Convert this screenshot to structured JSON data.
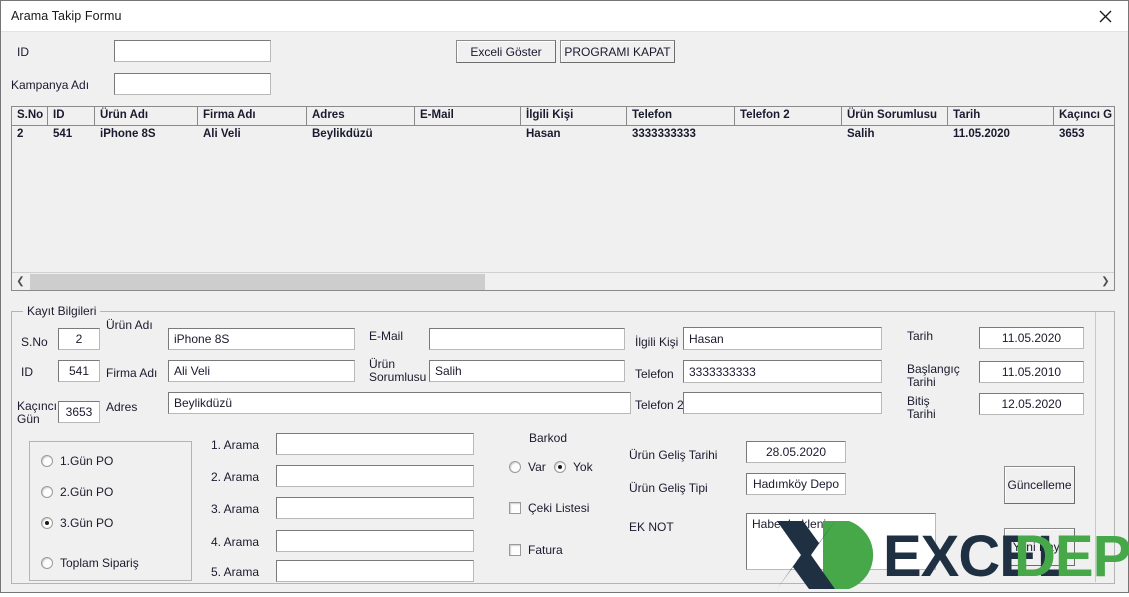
{
  "window": {
    "title": "Arama Takip Formu",
    "close_icon": "close-icon"
  },
  "search": {
    "id_label": "ID",
    "id_value": "",
    "campaign_label": "Kampanya Adı",
    "campaign_value": ""
  },
  "toolbar": {
    "show_excel_label": "Exceli Göster",
    "close_program_label": "PROGRAMI KAPAT"
  },
  "grid": {
    "columns": [
      {
        "label": "S.No",
        "width": 36
      },
      {
        "label": "ID",
        "width": 47
      },
      {
        "label": "Ürün Adı",
        "width": 103
      },
      {
        "label": "Firma Adı",
        "width": 109
      },
      {
        "label": "Adres",
        "width": 108
      },
      {
        "label": "E-Mail",
        "width": 106
      },
      {
        "label": "İlgili Kişi",
        "width": 106
      },
      {
        "label": "Telefon",
        "width": 108
      },
      {
        "label": "Telefon 2",
        "width": 107
      },
      {
        "label": "Ürün Sorumlusu",
        "width": 106
      },
      {
        "label": "Tarih",
        "width": 106
      },
      {
        "label": "Kaçıncı G",
        "width": 106
      }
    ],
    "rows": [
      [
        "2",
        "541",
        "iPhone 8S",
        "Ali Veli",
        "Beylikdüzü",
        "",
        "Hasan",
        "3333333333",
        "",
        "Salih",
        "11.05.2020",
        "3653"
      ]
    ],
    "scroll_left_icon": "chevron-left-icon",
    "scroll_right_icon": "chevron-right-icon"
  },
  "record": {
    "legend": "Kayıt Bilgileri",
    "sno_label": "S.No",
    "sno_value": "2",
    "id_label": "ID",
    "id_value": "541",
    "day_count_label": "Kaçıncı\nGün",
    "day_count_value": "3653",
    "product_label": "Ürün Adı",
    "product_value": "iPhone 8S",
    "company_label": "Firma Adı",
    "company_value": "Ali Veli",
    "address_label": "Adres",
    "address_value": "Beylikdüzü",
    "email_label": "E-Mail",
    "email_value": "",
    "product_owner_label": "Ürün\nSorumlusu",
    "product_owner_value": "Salih",
    "contact_label": "İlgili Kişi",
    "contact_value": "Hasan",
    "phone_label": "Telefon",
    "phone_value": "3333333333",
    "phone2_label": "Telefon  2",
    "phone2_value": "",
    "date_label": "Tarih",
    "date_value": "11.05.2020",
    "start_date_label": "Başlangıç\nTarihi",
    "start_date_value": "11.05.2010",
    "end_date_label": "Bitiş\nTarihi",
    "end_date_value": "12.05.2020"
  },
  "po_options": [
    {
      "label": "1.Gün PO",
      "selected": false
    },
    {
      "label": "2.Gün PO",
      "selected": false
    },
    {
      "label": "3.Gün PO",
      "selected": true
    },
    {
      "label": "Toplam Sipariş",
      "selected": false
    }
  ],
  "calls": [
    {
      "label": "1. Arama",
      "value": ""
    },
    {
      "label": "2. Arama",
      "value": ""
    },
    {
      "label": "3. Arama",
      "value": ""
    },
    {
      "label": "4. Arama",
      "value": ""
    },
    {
      "label": "5. Arama",
      "value": ""
    }
  ],
  "barcode": {
    "title": "Barkod",
    "yes_label": "Var",
    "yes_selected": false,
    "no_label": "Yok",
    "no_selected": true
  },
  "checkboxes": [
    {
      "label": "Çeki Listesi",
      "checked": false
    },
    {
      "label": "Fatura",
      "checked": false
    }
  ],
  "arrival": {
    "date_label": "Ürün Geliş Tarihi",
    "date_value": "28.05.2020",
    "type_label": "Ürün Geliş Tipi",
    "type_value": "Hadımköy Depo",
    "note_label": "EK NOT",
    "note_value": "Haber bekleniyor"
  },
  "actions": {
    "update_label": "Güncelleme",
    "new_record_label": "Yeni Kayıt"
  },
  "watermark": {
    "text_dark": "EXCEL",
    "text_green": "DEPO",
    "color_dark": "#1f3042",
    "color_green": "#46a848"
  }
}
